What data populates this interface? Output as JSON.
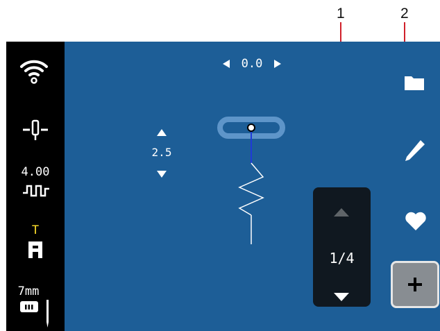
{
  "callouts": {
    "one": "1",
    "two": "2"
  },
  "sidebar": {
    "stitch_width_value": "4.00",
    "presser_foot_letter": "T",
    "needle_size": "7mm"
  },
  "stitch": {
    "width_value": "0.0",
    "length_value": "2.5"
  },
  "pager": {
    "indicator": "1/4"
  },
  "icons": {
    "wifi": "wifi-icon",
    "needle_position": "needle-position-icon",
    "stitch_width": "stitch-width-icon",
    "presser_foot": "presser-foot-icon",
    "needle_plate": "needle-plate-icon",
    "folder": "folder-icon",
    "edit": "pencil-icon",
    "favorite": "heart-icon",
    "add": "plus-icon"
  },
  "colors": {
    "screen_background": "#1d5e97",
    "sidebar_background": "#000000",
    "callout_line": "#d0202a",
    "foot_letter": "#ffe02a",
    "pager_background": "#101820",
    "add_button": "#888d92"
  }
}
